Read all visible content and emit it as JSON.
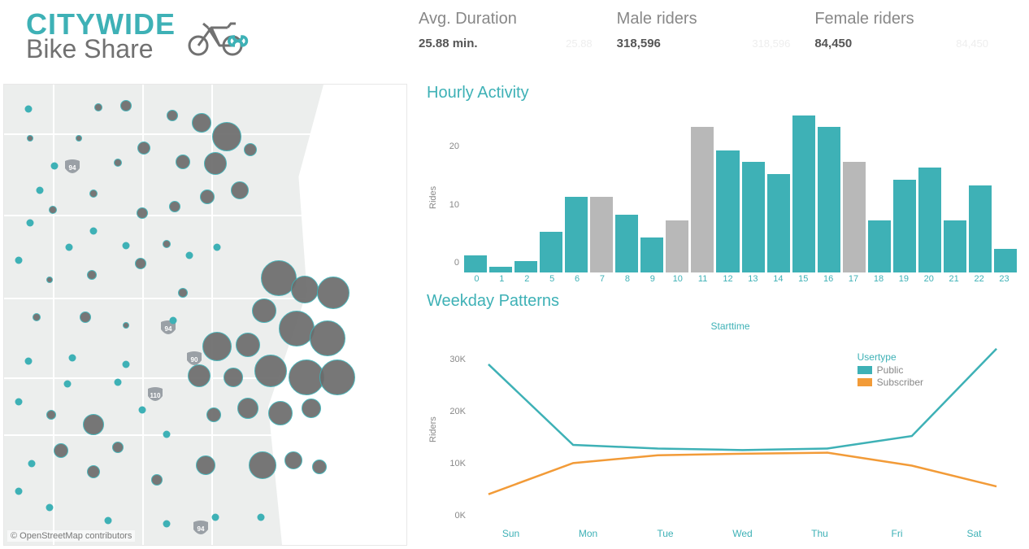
{
  "logo": {
    "line1": "CITYWIDE",
    "line2": "Bike Share",
    "icon": "bike-infinity-icon"
  },
  "kpis": [
    {
      "label": "Avg. Duration",
      "value": "25.88 min.",
      "ghost": "25.88"
    },
    {
      "label": "Male riders",
      "value": "318,596",
      "ghost": "318,596"
    },
    {
      "label": "Female riders",
      "value": "84,450",
      "ghost": "84,450"
    }
  ],
  "map": {
    "attribution": "© OpenStreetMap contributors",
    "shields": [
      "94",
      "94",
      "90",
      "110",
      "94"
    ]
  },
  "chart_data": [
    {
      "type": "bar",
      "title": "Hourly Activity",
      "ylabel": "Rides",
      "xlabel": "",
      "ylim": [
        0,
        28
      ],
      "yticks": [
        0,
        10,
        20
      ],
      "categories": [
        "0",
        "1",
        "2",
        "5",
        "6",
        "7",
        "8",
        "9",
        "10",
        "11",
        "12",
        "13",
        "14",
        "15",
        "16",
        "17",
        "18",
        "19",
        "20",
        "21",
        "22",
        "23"
      ],
      "values": [
        3,
        1,
        2,
        7,
        13,
        13,
        10,
        6,
        9,
        25,
        21,
        19,
        17,
        27,
        25,
        19,
        9,
        16,
        18,
        9,
        15,
        4
      ],
      "highlight_gray_indices": [
        5,
        8,
        9,
        15
      ]
    },
    {
      "type": "line",
      "title": "Weekday Patterns",
      "axis_title": "Starttime",
      "ylabel": "Riders",
      "xlabel": "",
      "ylim": [
        0,
        36000
      ],
      "yticks": [
        0,
        10000,
        20000,
        30000
      ],
      "ytick_labels": [
        "0K",
        "10K",
        "20K",
        "30K"
      ],
      "categories": [
        "Sun",
        "Mon",
        "Tue",
        "Wed",
        "Thu",
        "Fri",
        "Sat"
      ],
      "legend_title": "Usertype",
      "series": [
        {
          "name": "Public",
          "color": "#3eb1b6",
          "values": [
            31000,
            15500,
            14800,
            14500,
            14800,
            17200,
            34000
          ]
        },
        {
          "name": "Subscriber",
          "color": "#f29b38",
          "values": [
            6000,
            12000,
            13500,
            13800,
            14000,
            11500,
            7500
          ]
        }
      ]
    }
  ]
}
